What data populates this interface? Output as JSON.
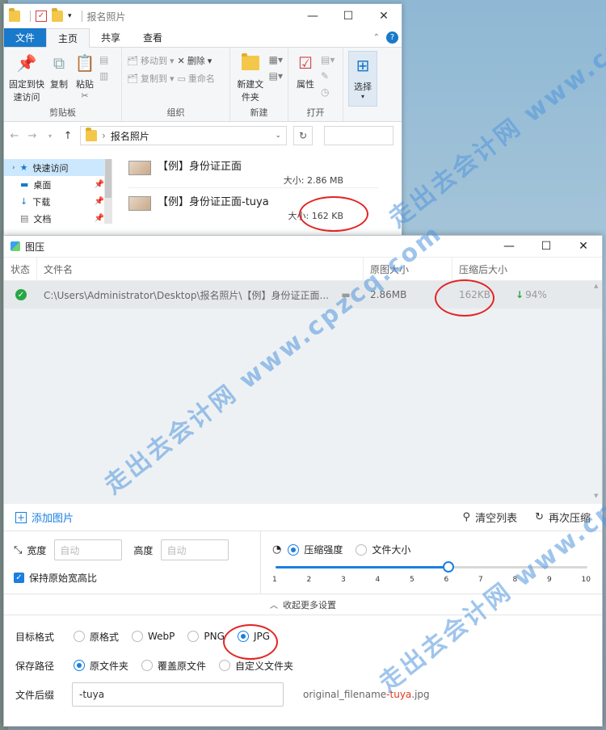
{
  "explorer": {
    "title": "报名照片",
    "ribbon_tabs": [
      "文件",
      "主页",
      "共享",
      "查看"
    ],
    "ribbon": {
      "pin_quick_access": "固定到快速访问",
      "copy": "复制",
      "paste": "粘贴",
      "clipboard_group": "剪贴板",
      "move_to": "移动到",
      "copy_to": "复制到",
      "delete": "删除",
      "rename": "重命名",
      "organize_group": "组织",
      "new_folder": "新建文件夹",
      "new_group": "新建",
      "properties": "属性",
      "open_group": "打开",
      "select": "选择"
    },
    "address": "报名照片",
    "nav": [
      {
        "label": "快速访问"
      },
      {
        "label": "桌面"
      },
      {
        "label": "下载"
      },
      {
        "label": "文档"
      }
    ],
    "files": [
      {
        "name": "【例】身份证正面",
        "size": "大小: 2.86 MB"
      },
      {
        "name": "【例】身份证正面-tuya",
        "size": "大小: 162 KB"
      }
    ]
  },
  "app": {
    "title": "图压",
    "columns": {
      "status": "状态",
      "filename": "文件名",
      "orig_size": "原图大小",
      "compressed_size": "压缩后大小"
    },
    "rows": [
      {
        "path": "C:\\Users\\Administrator\\Desktop\\报名照片\\【例】身份证正面....",
        "orig": "2.86MB",
        "compressed": "162KB",
        "ratio": "94%"
      }
    ],
    "actions": {
      "add": "添加图片",
      "clear": "清空列表",
      "recompress": "再次压缩"
    },
    "settings": {
      "width_label": "宽度",
      "width_placeholder": "自动",
      "height_label": "高度",
      "height_placeholder": "自动",
      "keep_ratio": "保持原始宽高比",
      "mode_strength": "压缩强度",
      "mode_size": "文件大小",
      "slider_ticks": [
        "1",
        "2",
        "3",
        "4",
        "5",
        "6",
        "7",
        "8",
        "9",
        "10"
      ],
      "slider_value": 6
    },
    "collapse_label": "收起更多设置",
    "more": {
      "format_label": "目标格式",
      "formats": [
        "原格式",
        "WebP",
        "PNG",
        "JPG"
      ],
      "format_selected": "JPG",
      "path_label": "保存路径",
      "paths": [
        "原文件夹",
        "覆盖原文件",
        "自定义文件夹"
      ],
      "path_selected": "原文件夹",
      "suffix_label": "文件后缀",
      "suffix_value": "-tuya",
      "preview_prefix": "original_filename",
      "preview_suffix": "-tuya",
      "preview_ext": ".jpg"
    }
  },
  "watermark": {
    "text_cn": "走出去会计网",
    "text_en": "www.cpzcq.com"
  },
  "colors": {
    "accent": "#1a7fe0",
    "success": "#28a745",
    "annotation": "#e32424",
    "file_tab": "#1979ca"
  }
}
